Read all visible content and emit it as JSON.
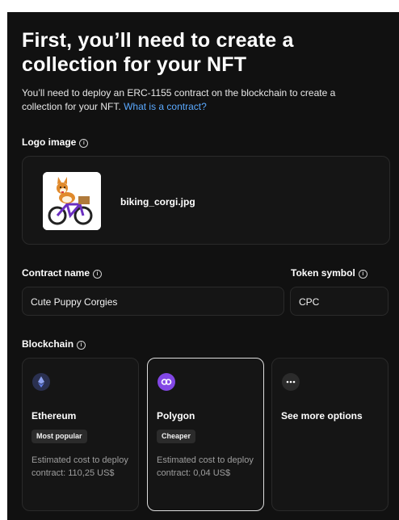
{
  "page": {
    "title": "First, you’ll need to create a collection for your NFT",
    "description": "You’ll need to deploy an ERC-1155 contract on the blockchain to create a collection for your NFT.",
    "description_link": "What is a contract?"
  },
  "logo": {
    "label": "Logo image",
    "file_name": "biking_corgi.jpg"
  },
  "contract": {
    "name_label": "Contract name",
    "name_value": "Cute Puppy Corgies",
    "symbol_label": "Token symbol",
    "symbol_value": "CPC"
  },
  "blockchain": {
    "label": "Blockchain",
    "options": [
      {
        "name": "Ethereum",
        "badge": "Most popular",
        "cost": "Estimated cost to deploy contract: 110,25 US$",
        "icon": "ethereum-icon",
        "color": "#627eea"
      },
      {
        "name": "Polygon",
        "badge": "Cheaper",
        "cost": "Estimated cost to deploy contract: 0,04 US$",
        "icon": "polygon-icon",
        "color": "#8247e5",
        "selected": true
      },
      {
        "name": "See more options",
        "icon": "more-icon"
      }
    ]
  },
  "info_icon": "ⓘ"
}
